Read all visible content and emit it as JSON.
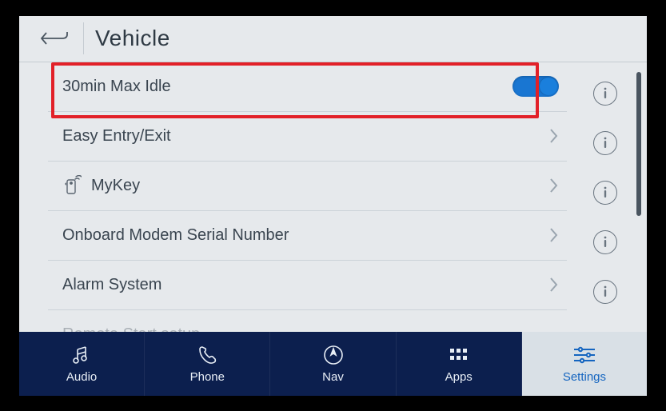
{
  "header": {
    "title": "Vehicle"
  },
  "list": {
    "items": [
      {
        "label": "30min Max Idle",
        "type": "toggle",
        "value": true
      },
      {
        "label": "Easy Entry/Exit",
        "type": "link"
      },
      {
        "label": "MyKey",
        "type": "link",
        "icon": "mykey-icon"
      },
      {
        "label": "Onboard Modem Serial Number",
        "type": "link"
      },
      {
        "label": "Alarm System",
        "type": "link"
      },
      {
        "label": "Remote Start setup",
        "type": "link",
        "partial": true
      }
    ]
  },
  "navbar": {
    "items": [
      {
        "id": "audio",
        "label": "Audio"
      },
      {
        "id": "phone",
        "label": "Phone"
      },
      {
        "id": "nav",
        "label": "Nav"
      },
      {
        "id": "apps",
        "label": "Apps"
      },
      {
        "id": "settings",
        "label": "Settings",
        "active": true
      }
    ]
  },
  "highlight": {
    "target_item_index": 0
  }
}
